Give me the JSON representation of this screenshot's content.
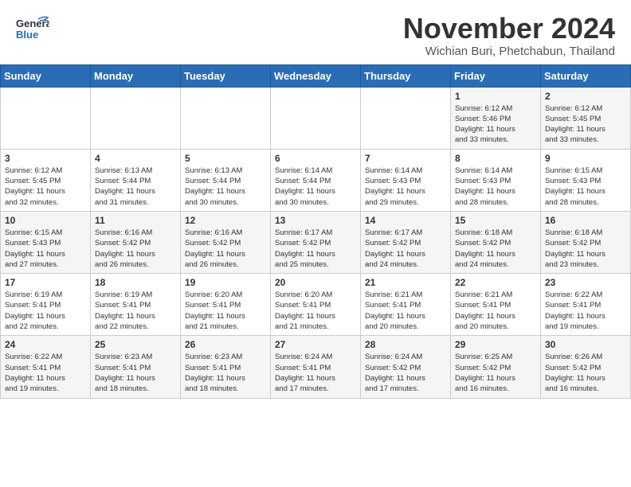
{
  "header": {
    "logo_general": "General",
    "logo_blue": "Blue",
    "month": "November 2024",
    "location": "Wichian Buri, Phetchabun, Thailand"
  },
  "weekdays": [
    "Sunday",
    "Monday",
    "Tuesday",
    "Wednesday",
    "Thursday",
    "Friday",
    "Saturday"
  ],
  "weeks": [
    [
      {
        "day": "",
        "info": ""
      },
      {
        "day": "",
        "info": ""
      },
      {
        "day": "",
        "info": ""
      },
      {
        "day": "",
        "info": ""
      },
      {
        "day": "",
        "info": ""
      },
      {
        "day": "1",
        "info": "Sunrise: 6:12 AM\nSunset: 5:46 PM\nDaylight: 11 hours\nand 33 minutes."
      },
      {
        "day": "2",
        "info": "Sunrise: 6:12 AM\nSunset: 5:45 PM\nDaylight: 11 hours\nand 33 minutes."
      }
    ],
    [
      {
        "day": "3",
        "info": "Sunrise: 6:12 AM\nSunset: 5:45 PM\nDaylight: 11 hours\nand 32 minutes."
      },
      {
        "day": "4",
        "info": "Sunrise: 6:13 AM\nSunset: 5:44 PM\nDaylight: 11 hours\nand 31 minutes."
      },
      {
        "day": "5",
        "info": "Sunrise: 6:13 AM\nSunset: 5:44 PM\nDaylight: 11 hours\nand 30 minutes."
      },
      {
        "day": "6",
        "info": "Sunrise: 6:14 AM\nSunset: 5:44 PM\nDaylight: 11 hours\nand 30 minutes."
      },
      {
        "day": "7",
        "info": "Sunrise: 6:14 AM\nSunset: 5:43 PM\nDaylight: 11 hours\nand 29 minutes."
      },
      {
        "day": "8",
        "info": "Sunrise: 6:14 AM\nSunset: 5:43 PM\nDaylight: 11 hours\nand 28 minutes."
      },
      {
        "day": "9",
        "info": "Sunrise: 6:15 AM\nSunset: 5:43 PM\nDaylight: 11 hours\nand 28 minutes."
      }
    ],
    [
      {
        "day": "10",
        "info": "Sunrise: 6:15 AM\nSunset: 5:43 PM\nDaylight: 11 hours\nand 27 minutes."
      },
      {
        "day": "11",
        "info": "Sunrise: 6:16 AM\nSunset: 5:42 PM\nDaylight: 11 hours\nand 26 minutes."
      },
      {
        "day": "12",
        "info": "Sunrise: 6:16 AM\nSunset: 5:42 PM\nDaylight: 11 hours\nand 26 minutes."
      },
      {
        "day": "13",
        "info": "Sunrise: 6:17 AM\nSunset: 5:42 PM\nDaylight: 11 hours\nand 25 minutes."
      },
      {
        "day": "14",
        "info": "Sunrise: 6:17 AM\nSunset: 5:42 PM\nDaylight: 11 hours\nand 24 minutes."
      },
      {
        "day": "15",
        "info": "Sunrise: 6:18 AM\nSunset: 5:42 PM\nDaylight: 11 hours\nand 24 minutes."
      },
      {
        "day": "16",
        "info": "Sunrise: 6:18 AM\nSunset: 5:42 PM\nDaylight: 11 hours\nand 23 minutes."
      }
    ],
    [
      {
        "day": "17",
        "info": "Sunrise: 6:19 AM\nSunset: 5:41 PM\nDaylight: 11 hours\nand 22 minutes."
      },
      {
        "day": "18",
        "info": "Sunrise: 6:19 AM\nSunset: 5:41 PM\nDaylight: 11 hours\nand 22 minutes."
      },
      {
        "day": "19",
        "info": "Sunrise: 6:20 AM\nSunset: 5:41 PM\nDaylight: 11 hours\nand 21 minutes."
      },
      {
        "day": "20",
        "info": "Sunrise: 6:20 AM\nSunset: 5:41 PM\nDaylight: 11 hours\nand 21 minutes."
      },
      {
        "day": "21",
        "info": "Sunrise: 6:21 AM\nSunset: 5:41 PM\nDaylight: 11 hours\nand 20 minutes."
      },
      {
        "day": "22",
        "info": "Sunrise: 6:21 AM\nSunset: 5:41 PM\nDaylight: 11 hours\nand 20 minutes."
      },
      {
        "day": "23",
        "info": "Sunrise: 6:22 AM\nSunset: 5:41 PM\nDaylight: 11 hours\nand 19 minutes."
      }
    ],
    [
      {
        "day": "24",
        "info": "Sunrise: 6:22 AM\nSunset: 5:41 PM\nDaylight: 11 hours\nand 19 minutes."
      },
      {
        "day": "25",
        "info": "Sunrise: 6:23 AM\nSunset: 5:41 PM\nDaylight: 11 hours\nand 18 minutes."
      },
      {
        "day": "26",
        "info": "Sunrise: 6:23 AM\nSunset: 5:41 PM\nDaylight: 11 hours\nand 18 minutes."
      },
      {
        "day": "27",
        "info": "Sunrise: 6:24 AM\nSunset: 5:41 PM\nDaylight: 11 hours\nand 17 minutes."
      },
      {
        "day": "28",
        "info": "Sunrise: 6:24 AM\nSunset: 5:42 PM\nDaylight: 11 hours\nand 17 minutes."
      },
      {
        "day": "29",
        "info": "Sunrise: 6:25 AM\nSunset: 5:42 PM\nDaylight: 11 hours\nand 16 minutes."
      },
      {
        "day": "30",
        "info": "Sunrise: 6:26 AM\nSunset: 5:42 PM\nDaylight: 11 hours\nand 16 minutes."
      }
    ]
  ]
}
